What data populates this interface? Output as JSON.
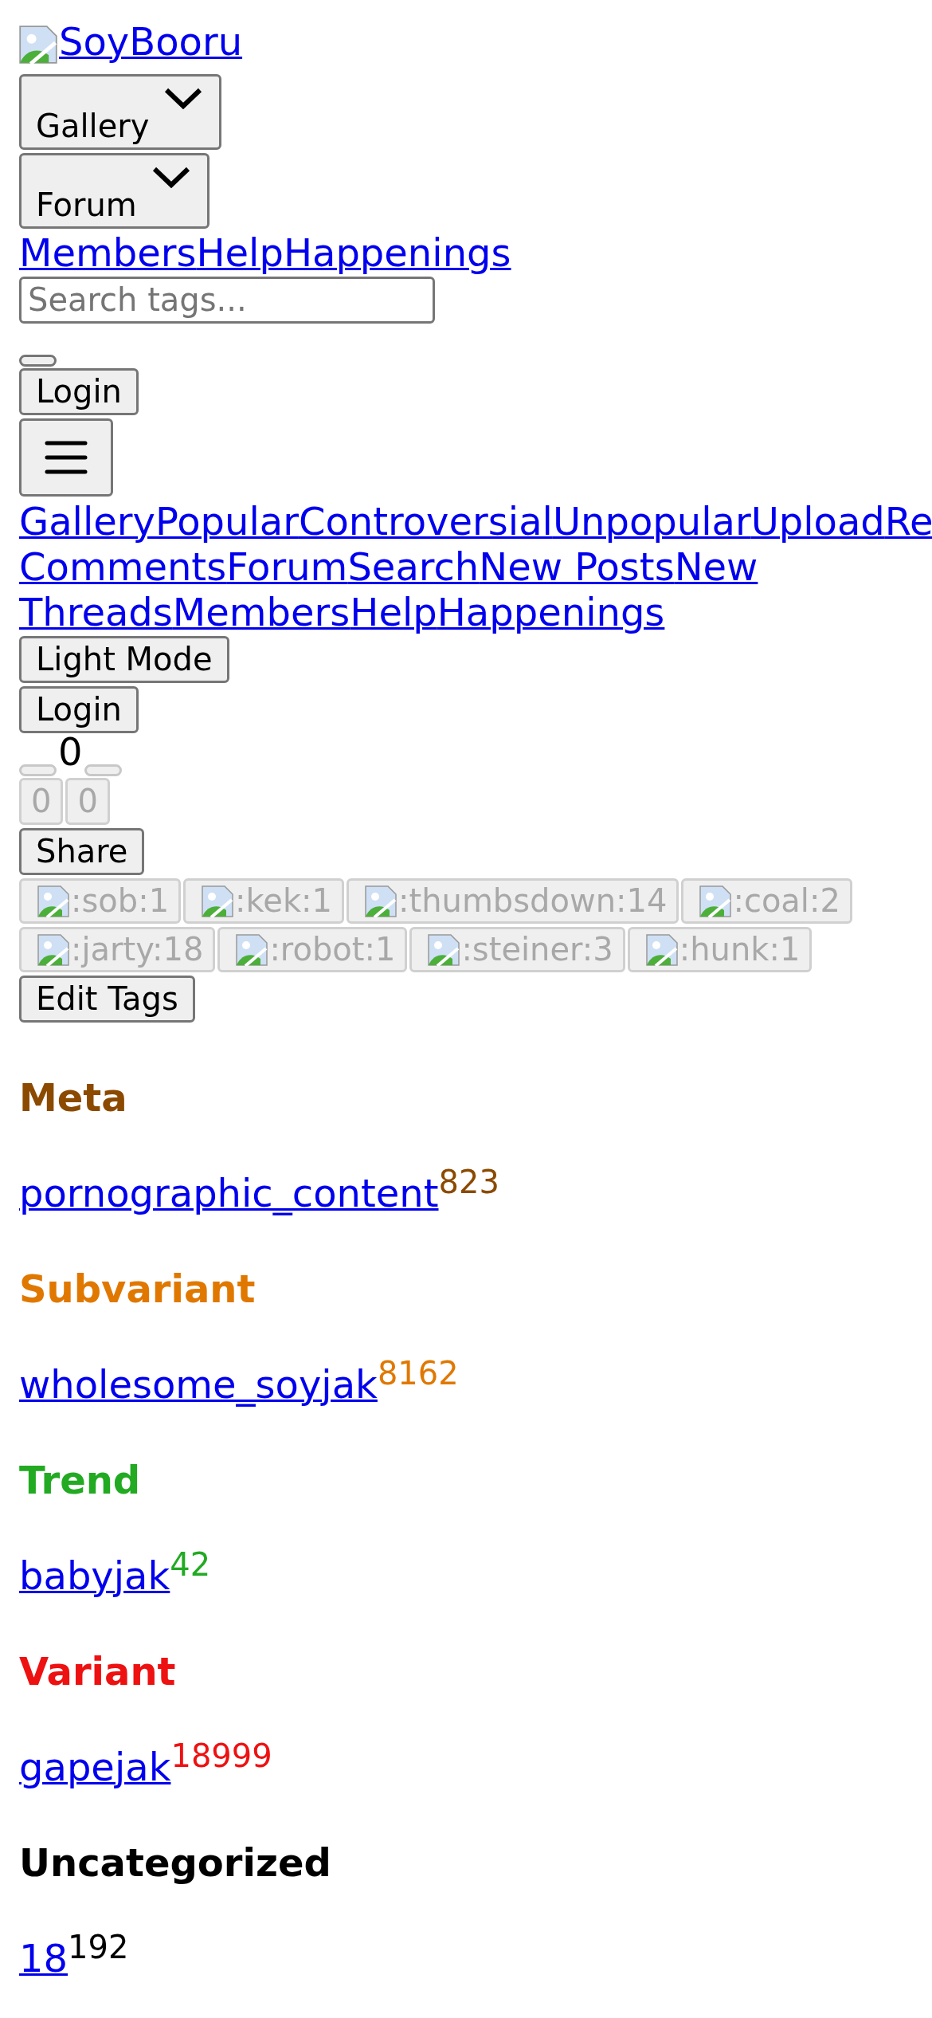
{
  "logo": {
    "text": "SoyBooru"
  },
  "dropdowns": [
    {
      "label": "Gallery"
    },
    {
      "label": "Forum"
    }
  ],
  "top_links": [
    "Members",
    "Help",
    "Happenings"
  ],
  "search": {
    "placeholder": "Search tags..."
  },
  "header_login": "Login",
  "menu_lines": [
    [
      "Gallery",
      "Popular",
      "Controversial",
      "Unpopular",
      "Upload",
      "Re"
    ],
    [
      "Comments",
      "Forum",
      "Search",
      "New Posts",
      "New"
    ],
    [
      "Threads",
      "Members",
      "Help",
      "Happenings"
    ]
  ],
  "light_mode": "Light Mode",
  "login": "Login",
  "vote": {
    "score": "0",
    "arrows": [
      {
        "disabled": true
      },
      {
        "disabled": true
      }
    ],
    "counts": [
      {
        "text": "0",
        "disabled": true
      },
      {
        "text": "0",
        "disabled": true
      }
    ]
  },
  "share": "Share",
  "reactions": [
    {
      "label": ":sob:1",
      "disabled": true
    },
    {
      "label": ":kek:1",
      "disabled": true
    },
    {
      "label": ":thumbsdown:14",
      "disabled": true
    },
    {
      "label": ":coal:2",
      "disabled": true
    },
    {
      "label": ":jarty:18",
      "disabled": true
    },
    {
      "label": ":robot:1",
      "disabled": true
    },
    {
      "label": ":steiner:3",
      "disabled": true
    },
    {
      "label": ":hunk:1",
      "disabled": true
    }
  ],
  "edit_tags": "Edit Tags",
  "tag_groups": [
    {
      "title": "Meta",
      "color": "#8b4a00",
      "tags": [
        {
          "name": "pornographic_content",
          "count": "823"
        }
      ]
    },
    {
      "title": "Subvariant",
      "color": "#e07800",
      "tags": [
        {
          "name": "wholesome_soyjak",
          "count": "8162"
        }
      ]
    },
    {
      "title": "Trend",
      "color": "#22aa22",
      "tags": [
        {
          "name": "babyjak",
          "count": "42"
        }
      ]
    },
    {
      "title": "Variant",
      "color": "#ee1111",
      "tags": [
        {
          "name": "gapejak",
          "count": "18999"
        }
      ]
    },
    {
      "title": "Uncategorized",
      "color": "#000000",
      "tags": [
        {
          "name": "18",
          "count": "192"
        }
      ]
    }
  ]
}
